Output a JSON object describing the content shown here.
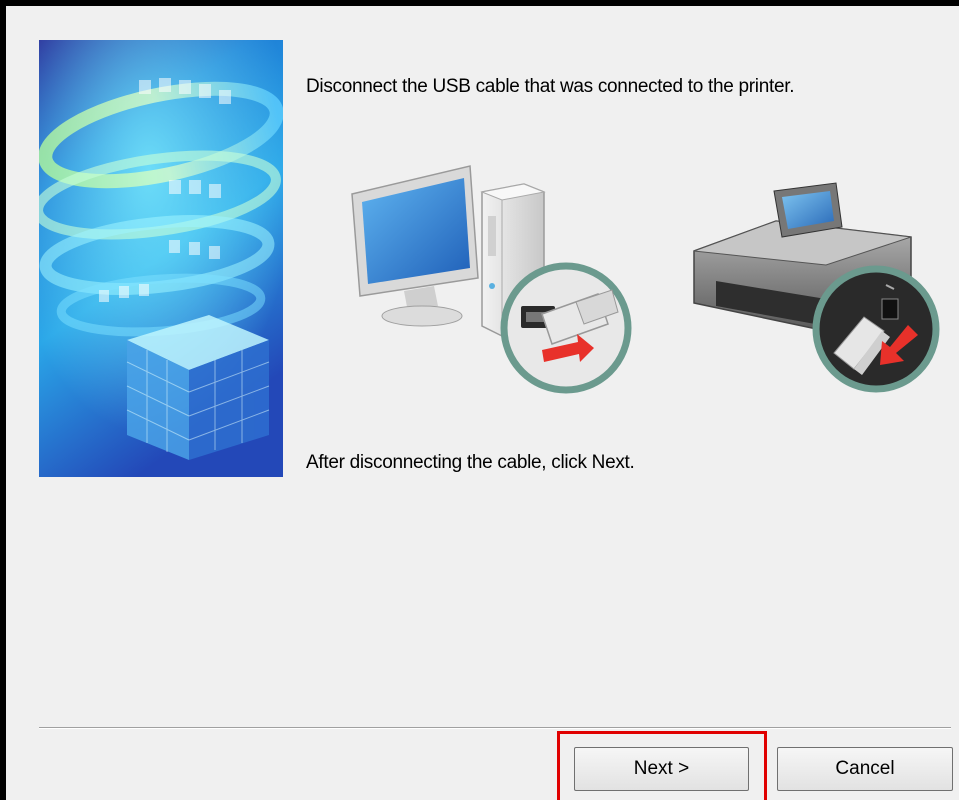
{
  "dialog": {
    "instruction_top": "Disconnect the USB cable that was connected to the printer.",
    "instruction_bottom": "After disconnecting the cable, click Next.",
    "illustrations": {
      "computer": "computer-usb-disconnect-illustration",
      "printer": "printer-usb-disconnect-illustration"
    },
    "side_banner": "installer-banner-image"
  },
  "buttons": {
    "next_label": "Next >",
    "cancel_label": "Cancel"
  },
  "annotation": {
    "highlight_target": "next-button",
    "highlight_color": "#e00000"
  },
  "colors": {
    "dialog_bg": "#f0f0f0",
    "disconnect_arrow": "#e8312a",
    "zoom_ring": "#6b9a8e"
  }
}
